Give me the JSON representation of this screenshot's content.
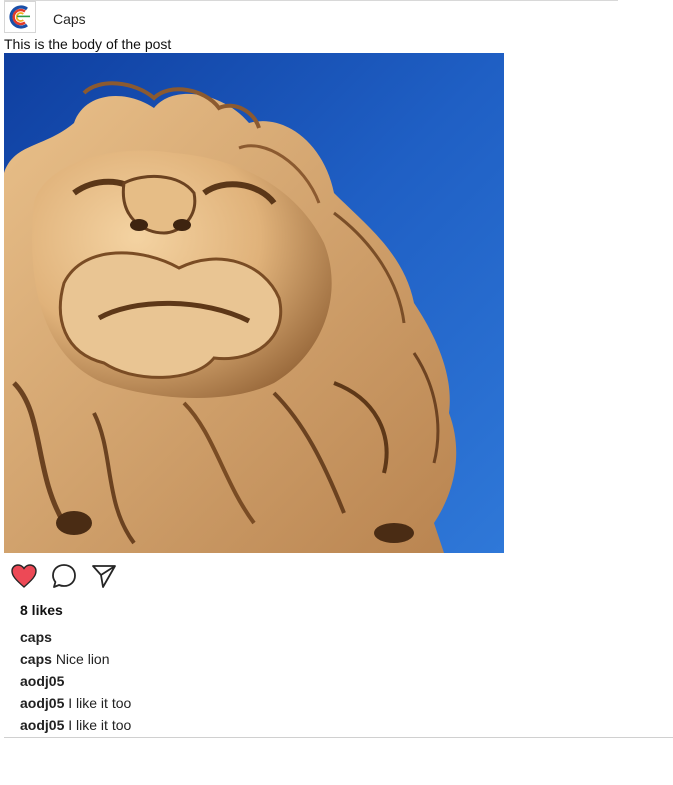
{
  "post": {
    "username": "Caps",
    "body": "This is the body of the post",
    "likes_label": "8 likes"
  },
  "icons": {
    "avatar": "logo-icon",
    "like": "heart-icon",
    "comment": "speech-bubble-icon",
    "share": "paper-plane-icon"
  },
  "colors": {
    "like_active": "#ed4956",
    "sky": "#1f5fc4"
  },
  "comments": [
    {
      "user": "caps",
      "text": ""
    },
    {
      "user": "caps",
      "text": "Nice lion"
    },
    {
      "user": "aodj05",
      "text": ""
    },
    {
      "user": "aodj05",
      "text": "I like it too"
    },
    {
      "user": "aodj05",
      "text": "I like it too"
    }
  ]
}
